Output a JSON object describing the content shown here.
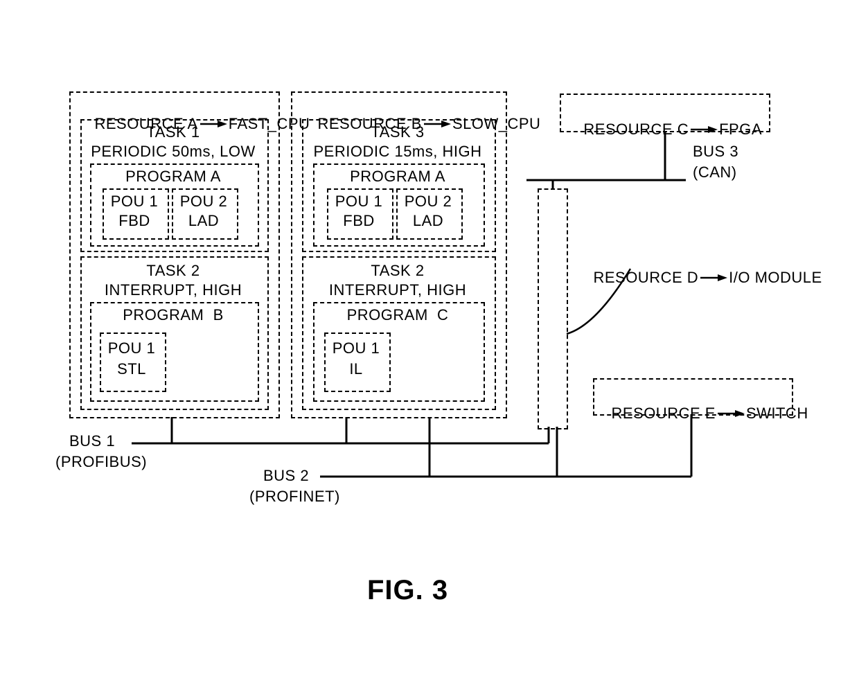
{
  "resourceA": {
    "header": {
      "name": "RESOURCE A",
      "target": "FAST_CPU"
    },
    "task1": {
      "title": "TASK 1",
      "sub": "PERIODIC 50ms, LOW",
      "program": {
        "title": "PROGRAM A",
        "pou1": {
          "l1": "POU 1",
          "l2": "FBD"
        },
        "pou2": {
          "l1": "POU 2",
          "l2": "LAD"
        }
      }
    },
    "task2": {
      "title": "TASK 2",
      "sub": "INTERRUPT, HIGH",
      "program": {
        "title": "PROGRAM  B",
        "pou1": {
          "l1": "POU 1",
          "l2": "STL"
        }
      }
    }
  },
  "resourceB": {
    "header": {
      "name": "RESOURCE B",
      "target": "SLOW_CPU"
    },
    "task3": {
      "title": "TASK 3",
      "sub": "PERIODIC 15ms, HIGH",
      "program": {
        "title": "PROGRAM A",
        "pou1": {
          "l1": "POU 1",
          "l2": "FBD"
        },
        "pou2": {
          "l1": "POU 2",
          "l2": "LAD"
        }
      }
    },
    "task2": {
      "title": "TASK 2",
      "sub": "INTERRUPT, HIGH",
      "program": {
        "title": "PROGRAM  C",
        "pou1": {
          "l1": "POU 1",
          "l2": "IL"
        }
      }
    }
  },
  "resourceC": {
    "name": "RESOURCE C",
    "target": "FPGA"
  },
  "resourceD": {
    "name": "RESOURCE D",
    "target": "I/O MODULE"
  },
  "resourceE": {
    "name": "RESOURCE E",
    "target": "SWITCH"
  },
  "bus1": {
    "l1": "BUS 1",
    "l2": "(PROFIBUS)"
  },
  "bus2": {
    "l1": "BUS 2",
    "l2": "(PROFINET)"
  },
  "bus3": {
    "l1": "BUS 3",
    "l2": "(CAN)"
  },
  "figure": "FIG. 3"
}
